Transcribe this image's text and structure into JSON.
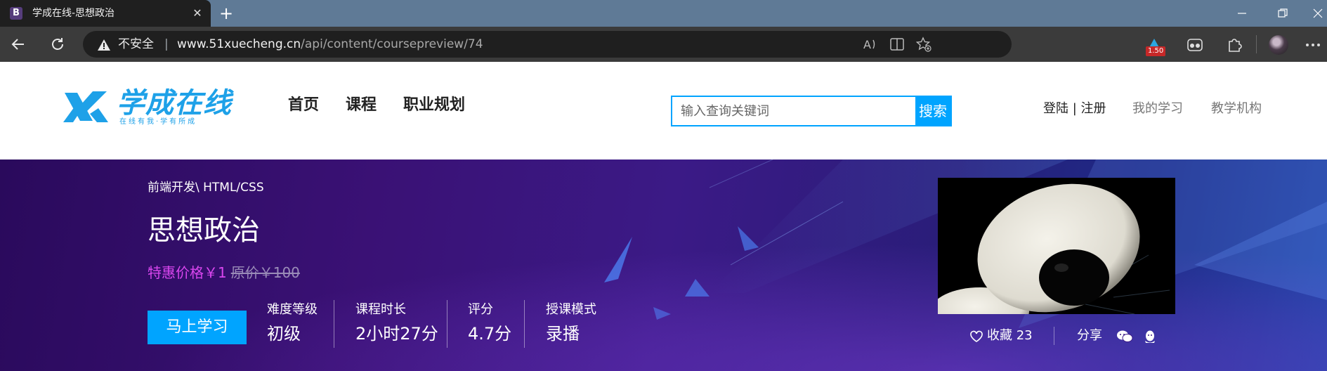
{
  "browser": {
    "tab_title": "学成在线-思想政治",
    "tab_favicon": "B",
    "security_label": "不安全",
    "url_host": "www.51xuecheng.cn",
    "url_path": "/api/content/coursepreview/74",
    "extension_badge": "1.50",
    "icons": [
      "back-icon",
      "refresh-icon",
      "warning-icon",
      "read-aloud-icon",
      "split-screen-icon",
      "favorites-add-icon",
      "extension-icon",
      "tracker-icon",
      "puzzle-icon",
      "more-icon"
    ]
  },
  "header": {
    "logo_text": "学成在线",
    "logo_slogan": "在线有我·学有所成",
    "nav": [
      "首页",
      "课程",
      "职业规划"
    ],
    "search_placeholder": "输入查询关键词",
    "search_button": "搜索",
    "login": "登陆 | 注册",
    "my_study": "我的学习",
    "org": "教学机构"
  },
  "course": {
    "breadcrumb": "前端开发\\ HTML/CSS",
    "title": "思想政治",
    "price_now": "特惠价格￥1",
    "price_old": "原价￥100",
    "learn_button": "马上学习",
    "stats": [
      {
        "label": "难度等级",
        "value": "初级"
      },
      {
        "label": "课程时长",
        "value": "2小时27分"
      },
      {
        "label": "评分",
        "value": "4.7分"
      },
      {
        "label": "授课模式",
        "value": "录播"
      }
    ],
    "favorite": "收藏 23",
    "share": "分享"
  },
  "colors": {
    "accent": "#00a4ff",
    "brand": "#1ea1e8",
    "price": "#d946ef",
    "hero_dark": "#2a0a5c"
  }
}
